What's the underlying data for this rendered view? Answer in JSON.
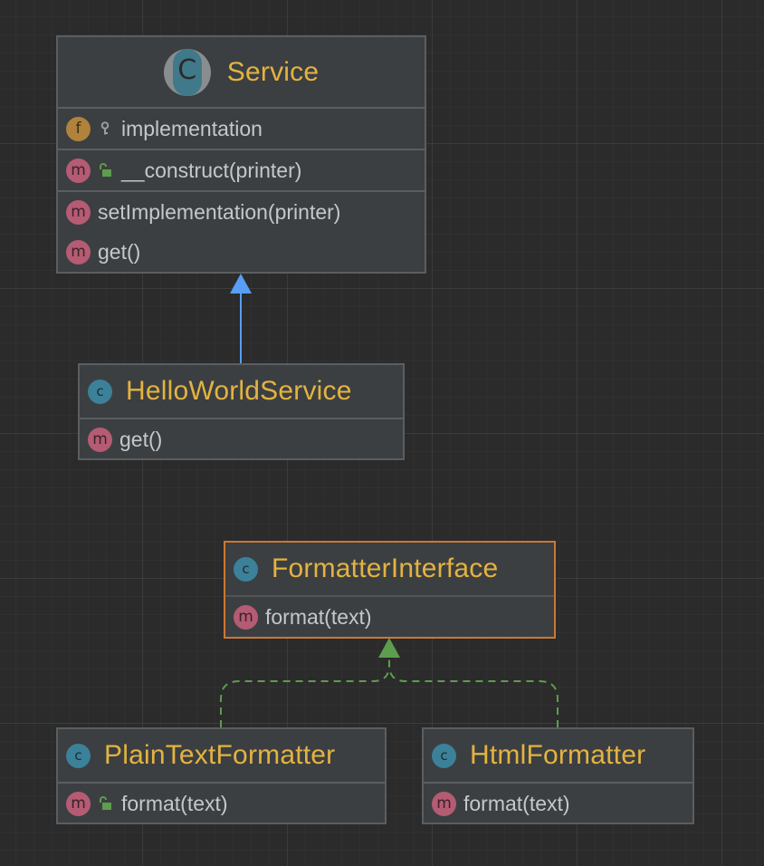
{
  "classes": {
    "service": {
      "name": "Service",
      "fields": [
        {
          "kind": "f",
          "visibility": "private",
          "label": "implementation"
        }
      ],
      "constructors": [
        {
          "kind": "m",
          "visibility": "public",
          "label": "__construct(printer)"
        }
      ],
      "methods": [
        {
          "kind": "m",
          "label": "setImplementation(printer)"
        },
        {
          "kind": "m",
          "label": "get()"
        }
      ]
    },
    "hello_world_service": {
      "name": "HelloWorldService",
      "methods": [
        {
          "kind": "m",
          "label": "get()"
        }
      ]
    },
    "formatter_interface": {
      "name": "FormatterInterface",
      "selected": true,
      "methods": [
        {
          "kind": "m",
          "label": "format(text)"
        }
      ]
    },
    "plain_text_formatter": {
      "name": "PlainTextFormatter",
      "methods": [
        {
          "kind": "m",
          "visibility": "public",
          "label": "format(text)"
        }
      ]
    },
    "html_formatter": {
      "name": "HtmlFormatter",
      "methods": [
        {
          "kind": "m",
          "label": "format(text)"
        }
      ]
    }
  },
  "relations": [
    {
      "from": "HelloWorldService",
      "to": "Service",
      "type": "extends",
      "color": "#589df6"
    },
    {
      "from": "PlainTextFormatter",
      "to": "FormatterInterface",
      "type": "implements",
      "color": "#5d9d4e"
    },
    {
      "from": "HtmlFormatter",
      "to": "FormatterInterface",
      "type": "implements",
      "color": "#5d9d4e"
    }
  ],
  "colors": {
    "background": "#2b2b2b",
    "node_fill": "#3c3f41",
    "node_border": "#5b5e60",
    "selected_border": "#cc7832",
    "class_name": "#e3b341",
    "member_text": "#c5c8cb",
    "extends_arrow": "#589df6",
    "implements_arrow": "#5d9d4e"
  }
}
